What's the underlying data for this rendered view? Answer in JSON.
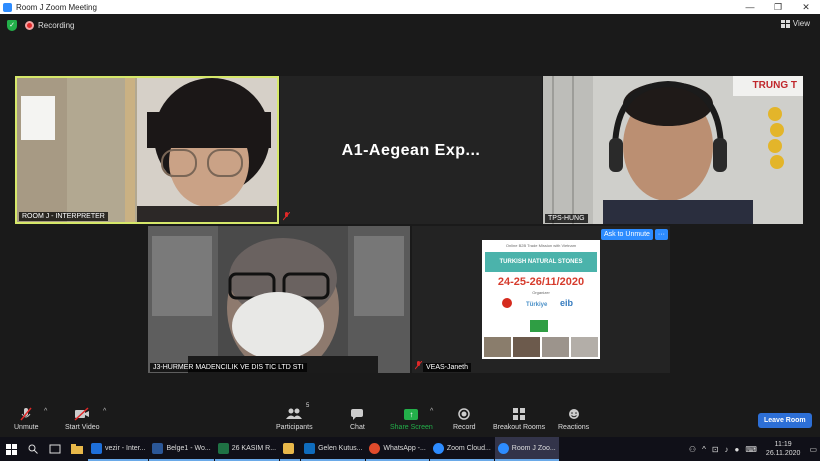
{
  "window": {
    "title": "Room J  Zoom Meeting",
    "controls": [
      "—",
      "❐",
      "✕"
    ]
  },
  "topbar": {
    "recording_label": "Recording",
    "view_label": "View"
  },
  "tiles": {
    "t1": {
      "name": "ROOM  J - INTERPRETER"
    },
    "t2": {
      "display_name": "A1-Aegean  Exp..."
    },
    "t3": {
      "name": "TPS-HUNG",
      "sign_text": "TRUNG T"
    },
    "t4": {
      "name": "J3-HURMER MADENCILIK VE DIS TIC LTD STI"
    },
    "t5": {
      "name": "VEAS-Janeth",
      "ask_to_unmute": "Ask to Unmute",
      "more": "···",
      "poster": {
        "header": "Online B2B Trade Mission with Vietnam",
        "banner": "TURKISH NATURAL STONES",
        "dates": "24-25-26/11/2020",
        "organizer": "Organizer",
        "logo_turkiye": "Türkiye",
        "logo_eib": "eib"
      }
    }
  },
  "toolbar": {
    "unmute": "Unmute",
    "start_video": "Start Video",
    "participants": "Participants",
    "participants_count": "5",
    "chat": "Chat",
    "share_screen": "Share Screen",
    "record": "Record",
    "breakout_rooms": "Breakout Rooms",
    "reactions": "Reactions",
    "leave": "Leave Room"
  },
  "taskbar": {
    "apps": [
      {
        "label": "vezir - Inter...",
        "color": "#1e6fd9"
      },
      {
        "label": "Belge1 - Wo...",
        "color": "#2b5797"
      },
      {
        "label": "26 KASIM R...",
        "color": "#1f7244"
      },
      {
        "label": "",
        "color": "#e8b84a"
      },
      {
        "label": "Gelen Kutus...",
        "color": "#0f6cbd"
      },
      {
        "label": "WhatsApp -...",
        "color": "#e04b2c"
      },
      {
        "label": "Zoom Cloud...",
        "color": "#2d8cff"
      },
      {
        "label": "Room J  Zoo...",
        "color": "#2d8cff"
      }
    ],
    "time": "11:19",
    "date": "26.11.2020"
  }
}
